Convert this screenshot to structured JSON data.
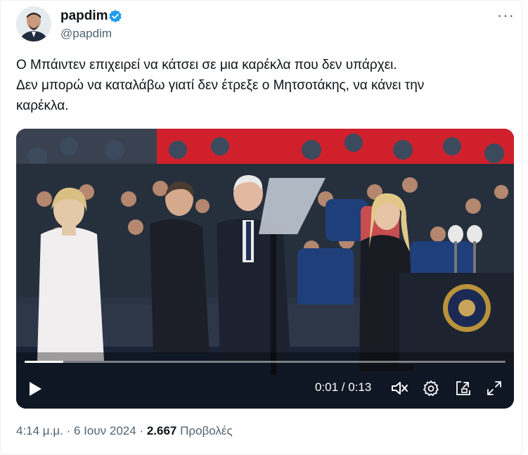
{
  "author": {
    "name": "papdim",
    "handle": "@papdim",
    "verified": true
  },
  "more_icon": "more-horizontal-icon",
  "tweet": {
    "lines": [
      "Ο Μπάιντεν επιχειρεί να κάτσει σε μια καρέκλα που δεν υπάρχει.",
      "Δεν μπορώ να καταλάβω γιατί δεν έτρεξε ο Μητσοτάκης, να κάνει την",
      "καρέκλα."
    ]
  },
  "video": {
    "time_display": "0:01 / 0:13",
    "progress_fraction": 0.08,
    "controls": [
      "play-icon",
      "mute-icon",
      "settings-icon",
      "picture-in-picture-icon",
      "fullscreen-icon"
    ]
  },
  "footer": {
    "time": "4:14 μ.μ.",
    "separator": "·",
    "date": "6 Ιουν 2024",
    "views_count": "2.667",
    "views_label": "Προβολές"
  },
  "colors": {
    "verified_blue": "#1d9bf0",
    "secondary_text": "#536471",
    "primary_text": "#0f1419"
  }
}
